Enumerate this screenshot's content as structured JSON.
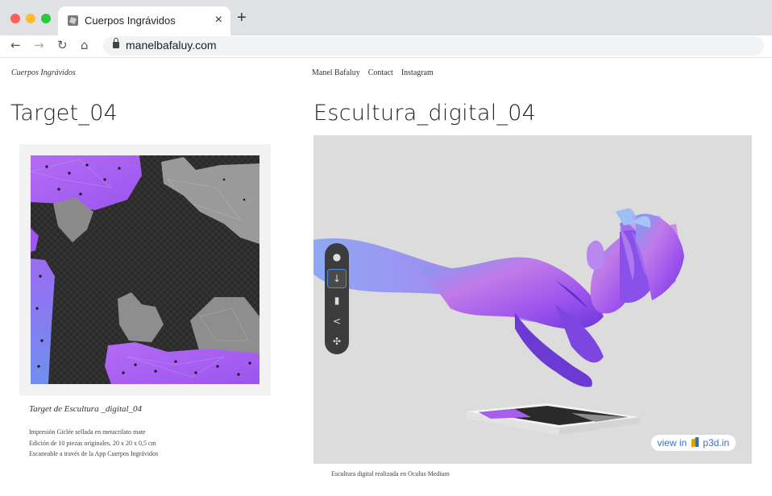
{
  "browser": {
    "tab_title": "Cuerpos Ingrávidos",
    "tab_close": "×",
    "new_tab": "+",
    "url": "manelbafaluy.com",
    "nav": {
      "back": "←",
      "forward": "→",
      "reload": "↻",
      "home": "⌂"
    }
  },
  "page": {
    "site_name": "Cuerpos Ingrávidos",
    "menu": [
      "Manel Bafaluy",
      "Contact",
      "Instagram"
    ],
    "left_title": "Target_04",
    "right_title": "Escultura_digital_04",
    "artwork_caption": {
      "title": "Target de Escultura _digital_04",
      "lines": [
        "Impresión Giclée sellada en metacrilato mate",
        "Edición de 10 piezas originales, 20 x 20  x 0,5 cm",
        "Escaneable a través de la App Cuerpos Ingrávidos"
      ]
    },
    "viewer": {
      "badge_prefix": "view in",
      "badge_brand": "p3d.in",
      "tools": [
        "sphere-icon",
        "down-arrow-icon",
        "mouse-icon",
        "share-icon",
        "expand-icon"
      ],
      "caption": "Escultura digital realizada en Oculus Medium"
    }
  },
  "colors": {
    "purple": "#a25ef0",
    "violet": "#7b3fe0",
    "gray_shape": "#8a8a8a",
    "dark_bg": "#2b2b2b",
    "link_blue": "#3b6fc4"
  }
}
